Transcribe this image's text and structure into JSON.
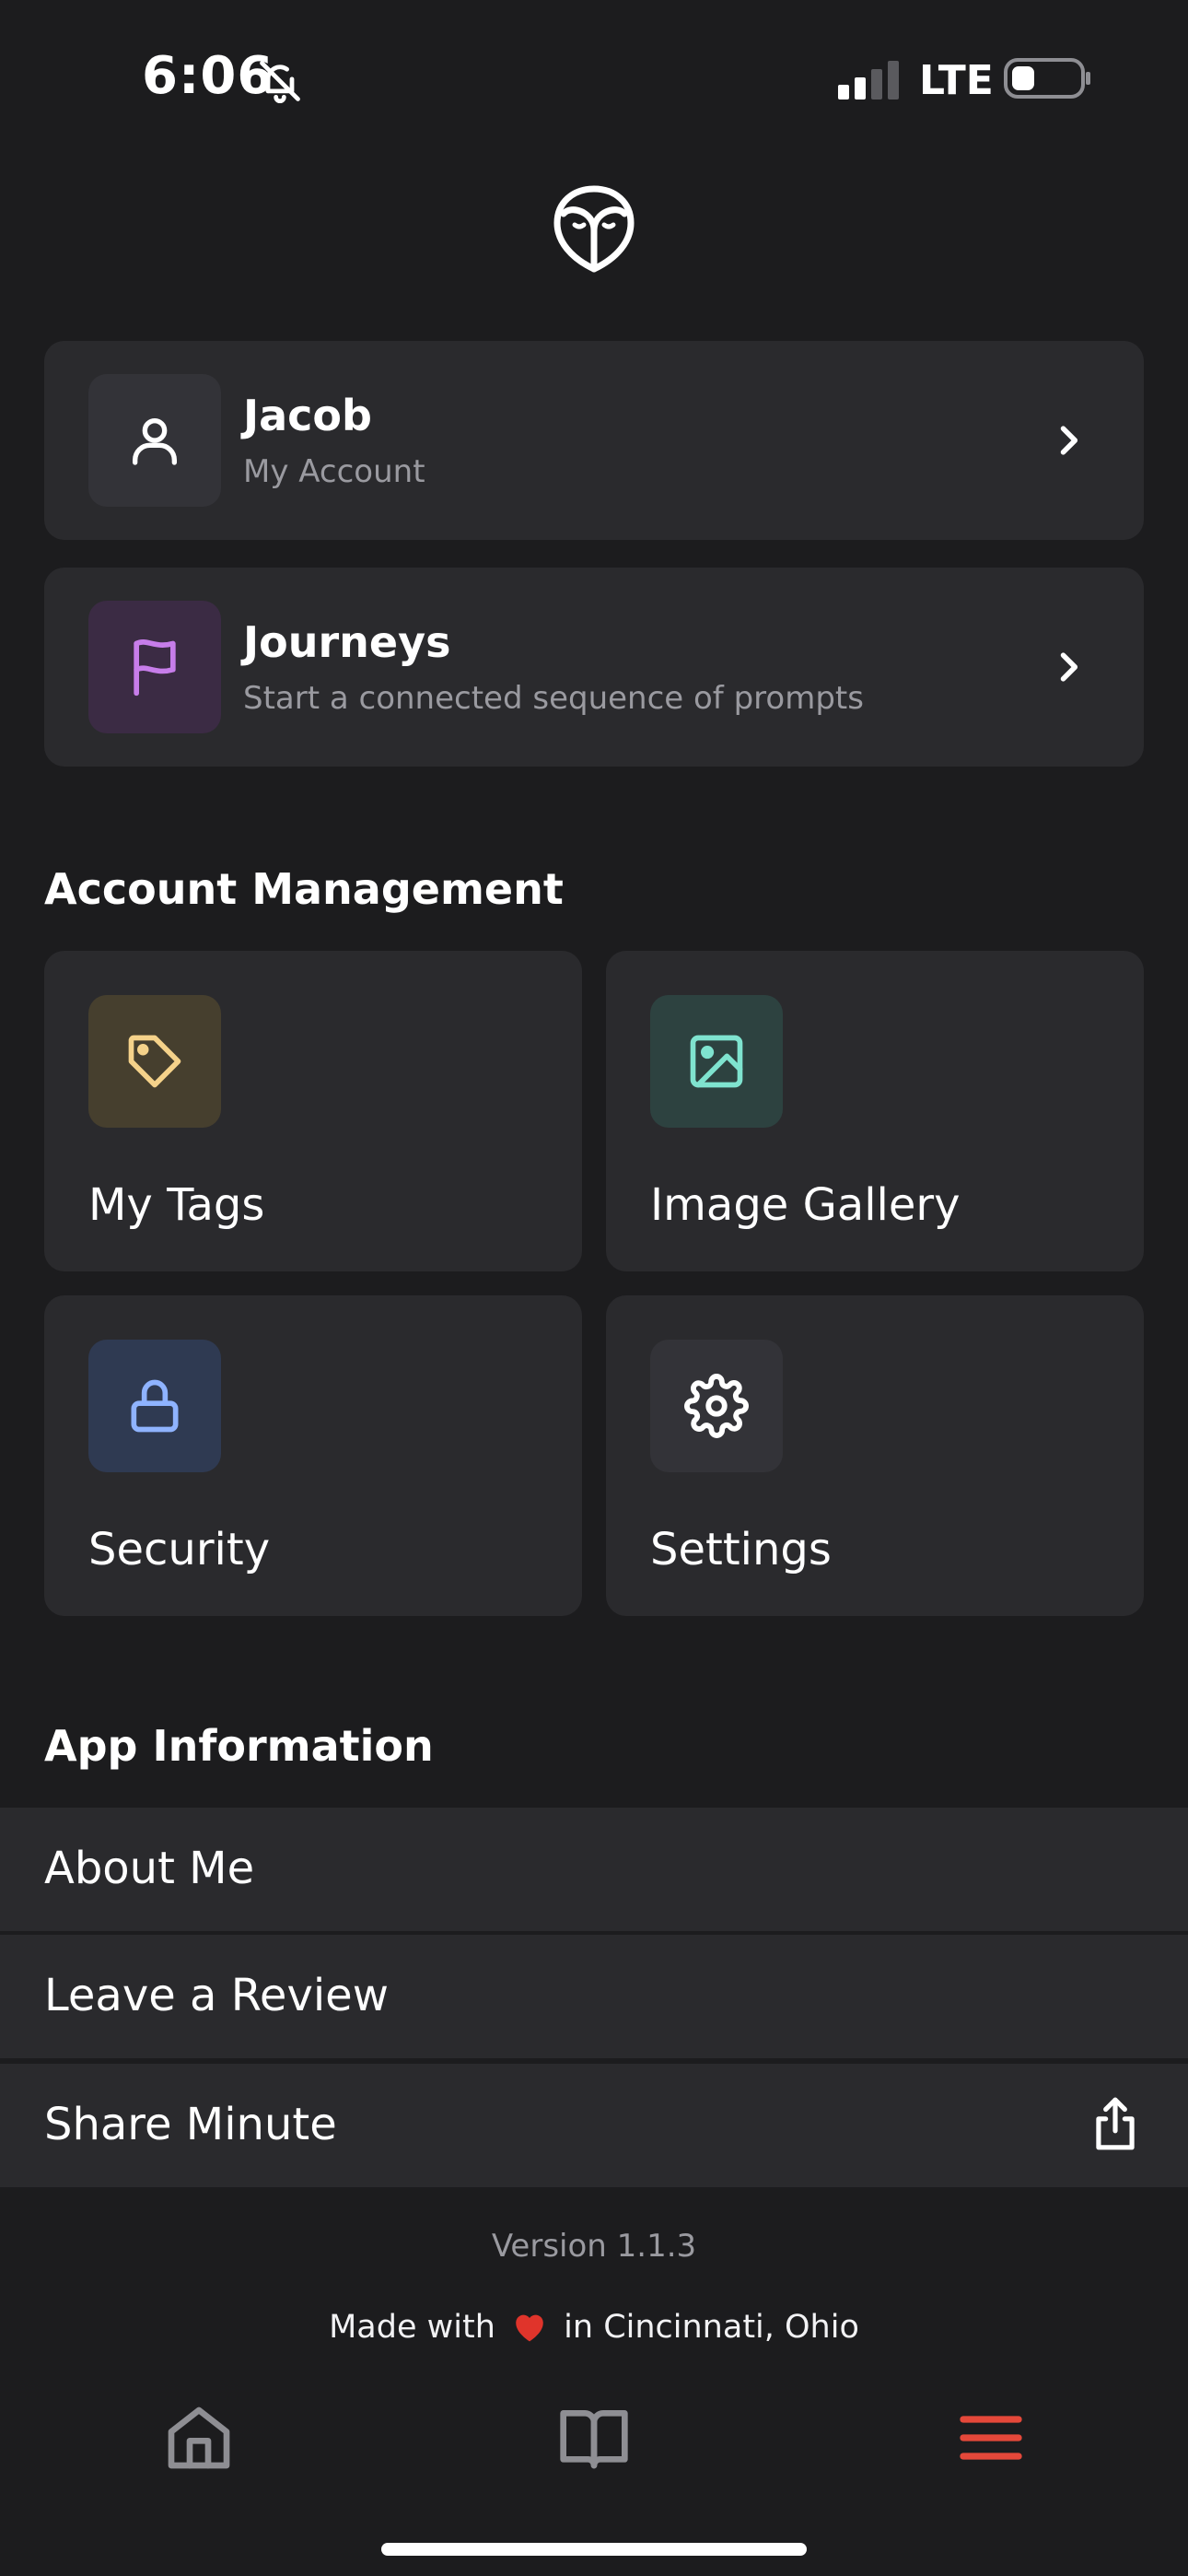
{
  "status_bar": {
    "time": "6:06",
    "carrier": "LTE"
  },
  "account_card": {
    "name": "Jacob",
    "subtitle": "My Account"
  },
  "journeys_card": {
    "title": "Journeys",
    "subtitle": "Start a connected sequence of prompts"
  },
  "account_management": {
    "heading": "Account Management",
    "tiles": [
      {
        "label": "My Tags",
        "icon": "tag-icon",
        "color": "#f5d28a"
      },
      {
        "label": "Image Gallery",
        "icon": "image-icon",
        "color": "#7fe3cf"
      },
      {
        "label": "Security",
        "icon": "lock-icon",
        "color": "#8fb3ff"
      },
      {
        "label": "Settings",
        "icon": "gear-icon",
        "color": "#ffffff"
      }
    ]
  },
  "app_information": {
    "heading": "App Information",
    "rows": [
      "About Me",
      "Leave a Review",
      "Share Minute"
    ]
  },
  "footer": {
    "version": "Version 1.1.3",
    "made_prefix": "Made with",
    "made_suffix": "in Cincinnati, Ohio"
  },
  "colors": {
    "background": "#1c1c1e",
    "card": "#2a2a2d",
    "accent_active": "#e5483a",
    "journeys_purple": "#c77dea"
  }
}
